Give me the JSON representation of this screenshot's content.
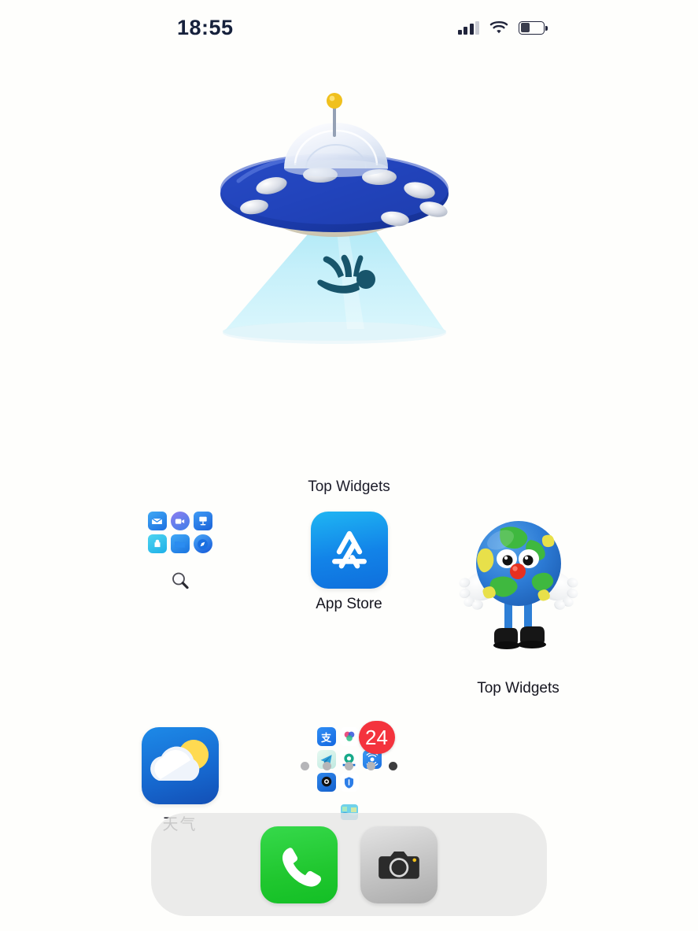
{
  "status_bar": {
    "time": "18:55",
    "signal_icon": "cellular-signal-icon",
    "signal_bars_filled": 3,
    "signal_bars_total": 4,
    "wifi_icon": "wifi-icon",
    "battery_icon": "battery-icon",
    "battery_percent": 40
  },
  "widgets": {
    "ufo": {
      "label": "Top Widgets",
      "icon": "ufo-abduction-illustration",
      "colors": {
        "saucer": "#1a3fb0",
        "beam": "#c6eff8",
        "antenna_ball": "#f2c21a"
      }
    },
    "globe": {
      "label": "Top Widgets",
      "icon": "globe-character-illustration",
      "colors": {
        "globe_base": "#2b7fd4",
        "land": "#3fb83f",
        "nose": "#e8301f",
        "shoes": "#1a1a1a"
      }
    }
  },
  "apps": {
    "row1": [
      {
        "name": "utilities-folder",
        "type": "folder",
        "label": "",
        "mini_icons": [
          {
            "name": "mail-icon",
            "glyph": "✉",
            "color": "#2b8cf0"
          },
          {
            "name": "facetime-icon",
            "glyph": "▶",
            "color": "#7a63e8"
          },
          {
            "name": "signage-app-icon",
            "glyph": "⚑",
            "color": "#1f7fe8"
          },
          {
            "name": "app-store-mini-icon",
            "glyph": "▲",
            "color": "#35c3e8"
          },
          {
            "name": "files-icon",
            "glyph": "▬",
            "color": "#2e9cf5"
          },
          {
            "name": "safari-icon",
            "glyph": "✦",
            "color": "#2175e8"
          }
        ],
        "search_icon": "search-magnifier-icon"
      },
      {
        "name": "app-store",
        "type": "app",
        "label": "App Store",
        "icon": "app-store-icon"
      },
      {
        "name": "top-widgets-globe",
        "type": "widget",
        "label": "Top Widgets",
        "icon": "globe-character-icon"
      }
    ],
    "row2": [
      {
        "name": "weather",
        "type": "app",
        "label": "天气",
        "icon": "weather-icon"
      },
      {
        "name": "chinese-apps-folder",
        "type": "folder",
        "label": "",
        "badge": "24",
        "badge_color": "#f4333d",
        "mini_icons": [
          {
            "name": "alipay-icon",
            "glyph": "支",
            "color": "#1677ff"
          },
          {
            "name": "color-rings-app-icon",
            "glyph": "●",
            "color": "#ffffff"
          },
          {
            "name": "red-festival-app-icon",
            "glyph": "☀",
            "color": "#e23b2e"
          },
          {
            "name": "telegram-icon",
            "glyph": "➤",
            "color": "#e8f7f2"
          },
          {
            "name": "green-bank-app-icon",
            "glyph": "◉",
            "color": "#ffffff"
          },
          {
            "name": "wifi-tool-app-icon",
            "glyph": "(g)",
            "color": "#1f7fe8"
          },
          {
            "name": "dark-circle-app-icon",
            "glyph": "●",
            "color": "#1f6fd4"
          },
          {
            "name": "shield-security-app-icon",
            "glyph": "⛨",
            "color": "#ffffff"
          }
        ],
        "stray_icon": "map-thumbnail-icon"
      }
    ]
  },
  "page_dots": {
    "count": 5,
    "active_index": 4
  },
  "dock": {
    "items": [
      {
        "name": "phone",
        "label": "Phone",
        "icon": "phone-handset-icon",
        "color": "#20c72f"
      },
      {
        "name": "camera",
        "label": "Camera",
        "icon": "camera-icon",
        "color": "#c6c6c6"
      }
    ]
  }
}
